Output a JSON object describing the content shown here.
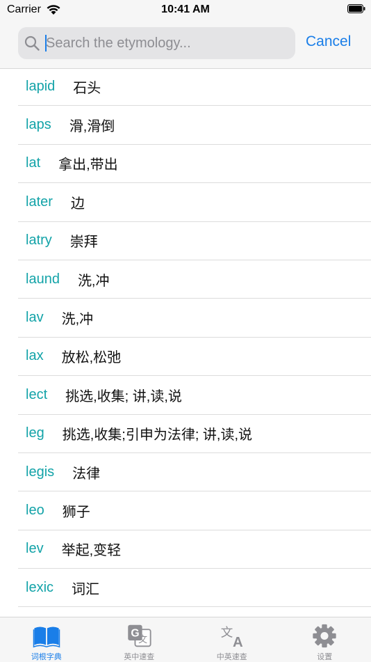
{
  "status_bar": {
    "carrier": "Carrier",
    "time": "10:41 AM"
  },
  "search": {
    "placeholder": "Search the etymology...",
    "value": "",
    "cancel_label": "Cancel"
  },
  "roots": [
    {
      "root": "lapid",
      "meaning": "石头"
    },
    {
      "root": "laps",
      "meaning": "滑,滑倒"
    },
    {
      "root": "lat",
      "meaning": "拿出,带出"
    },
    {
      "root": "later",
      "meaning": "边"
    },
    {
      "root": "latry",
      "meaning": "崇拜"
    },
    {
      "root": "laund",
      "meaning": "洗,冲"
    },
    {
      "root": "lav",
      "meaning": "洗,冲"
    },
    {
      "root": "lax",
      "meaning": "放松,松弛"
    },
    {
      "root": "lect",
      "meaning": "挑选,收集; 讲,读,说"
    },
    {
      "root": "leg",
      "meaning": "挑选,收集;引申为法律; 讲,读,说"
    },
    {
      "root": "legis",
      "meaning": "法律"
    },
    {
      "root": "leo",
      "meaning": "狮子"
    },
    {
      "root": "lev",
      "meaning": "举起,变轻"
    },
    {
      "root": "lexic",
      "meaning": "词汇"
    }
  ],
  "tabs": [
    {
      "label": "词根字典",
      "icon": "book-icon",
      "active": true
    },
    {
      "label": "英中速查",
      "icon": "translate-g-icon",
      "active": false
    },
    {
      "label": "中英速查",
      "icon": "translate-a-icon",
      "active": false
    },
    {
      "label": "设置",
      "icon": "gear-icon",
      "active": false
    }
  ],
  "colors": {
    "accent": "#1a7ee8",
    "root_text": "#13a3a8",
    "inactive_icon": "#8e8e93"
  }
}
